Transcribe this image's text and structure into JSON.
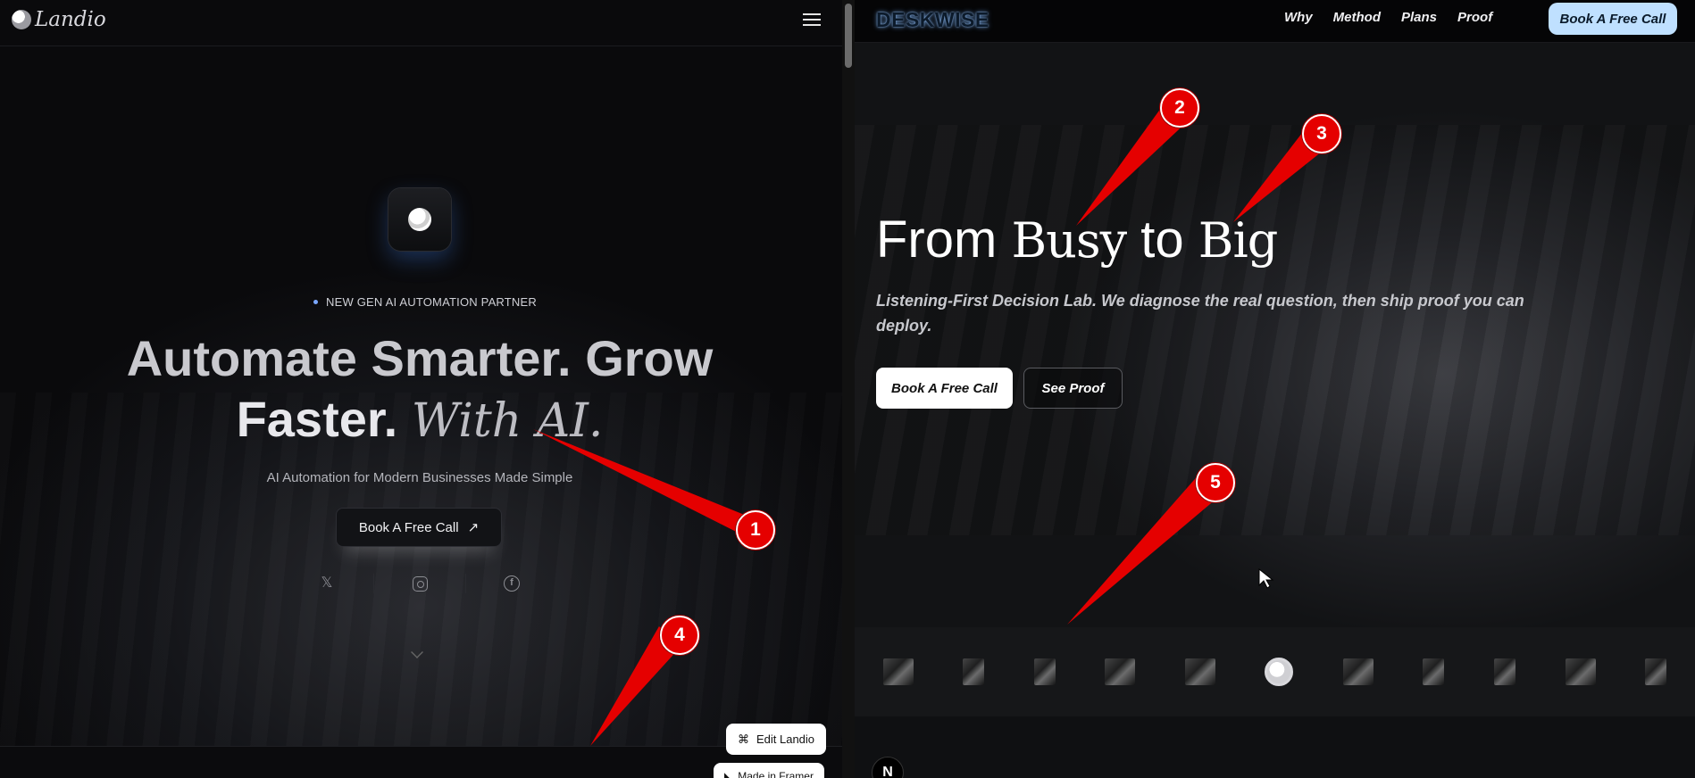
{
  "left": {
    "brand": "Landio",
    "tagline": "NEW GEN AI AUTOMATION PARTNER",
    "hero": {
      "line1a": "Automate Smarter.",
      "line1b": "Grow",
      "line2a": "Faster.",
      "line2b": "With AI."
    },
    "subtitle": "AI Automation for Modern Businesses Made Simple",
    "cta": "Book A Free Call",
    "edit_button": "Edit Landio",
    "framer_badge": "Made in Framer"
  },
  "right": {
    "brand": "DESKWISE",
    "nav": [
      "Why",
      "Method",
      "Plans",
      "Proof"
    ],
    "nav_cta": "Book A Free Call",
    "hero": {
      "title_a": "From",
      "title_b": "Busy",
      "title_c": "to",
      "title_d": "Big"
    },
    "subtitle": "Listening-First Decision Lab. We diagnose the real question, then ship proof you can deploy.",
    "primary_cta": "Book A Free Call",
    "secondary_cta": "See Proof",
    "badge": "N"
  },
  "markers": [
    "1",
    "2",
    "3",
    "4",
    "5"
  ],
  "colors": {
    "marker_red": "#e50000",
    "nav_cta_bg": "#bfe0ff",
    "tagline_dot": "#7aa7ff"
  }
}
